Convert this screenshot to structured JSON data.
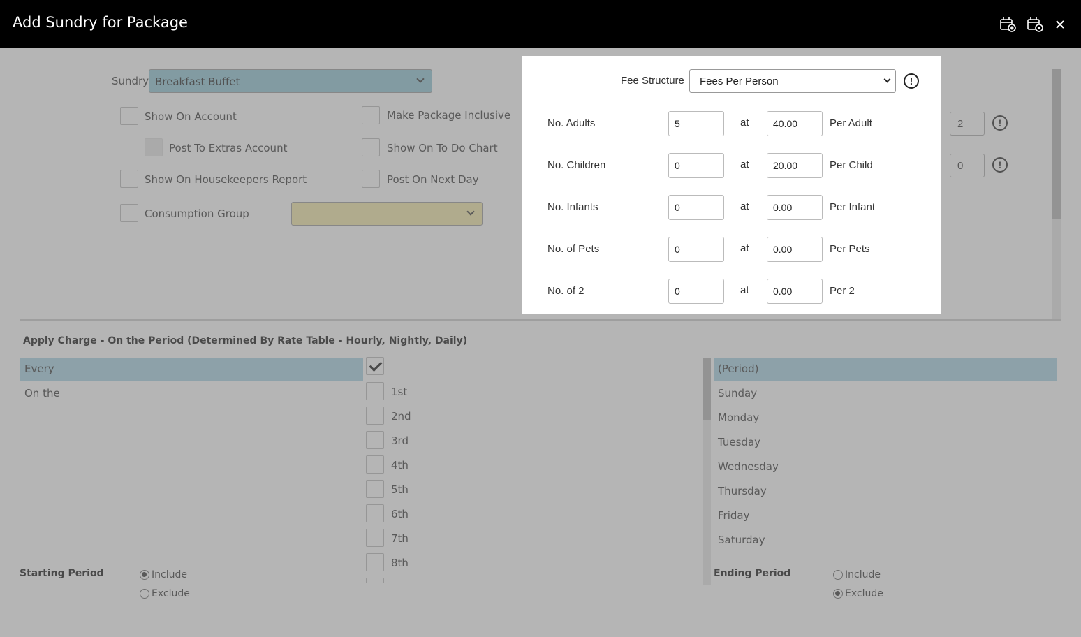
{
  "window": {
    "title": "Add Sundry for Package"
  },
  "header_icons": [
    "save-new-icon",
    "save-close-icon",
    "close-icon"
  ],
  "sundry": {
    "label": "Sundry",
    "value": "Breakfast Buffet"
  },
  "options": {
    "show_on_account": "Show On Account",
    "post_to_extras": "Post To Extras Account",
    "show_on_housekeepers": "Show On Housekeepers Report",
    "consumption_group": "Consumption Group",
    "make_package_inclusive": "Make Package Inclusive",
    "show_on_todo": "Show On To Do Chart",
    "post_next_day": "Post On Next Day"
  },
  "side_values": {
    "first": "2",
    "second": "0"
  },
  "apply_charge": {
    "heading": "Apply Charge - On the Period (Determined By Rate Table - Hourly, Nightly, Daily)",
    "frequency": [
      "Every",
      "On the"
    ],
    "selected_frequency": "Every",
    "ordinals": [
      "1st",
      "2nd",
      "3rd",
      "4th",
      "5th",
      "6th",
      "7th",
      "8th"
    ],
    "periods": [
      "(Period)",
      "Sunday",
      "Monday",
      "Tuesday",
      "Wednesday",
      "Thursday",
      "Friday",
      "Saturday"
    ],
    "selected_period": "(Period)"
  },
  "starting_period": {
    "label": "Starting Period",
    "include": "Include",
    "exclude": "Exclude",
    "selected": "Include"
  },
  "ending_period": {
    "label": "Ending Period",
    "include": "Include",
    "exclude": "Exclude",
    "selected": "Exclude"
  },
  "fee_popup": {
    "fee_structure_label": "Fee Structure",
    "fee_structure_value": "Fees Per Person",
    "at": "at",
    "rows": [
      {
        "label": "No. Adults",
        "qty": "5",
        "price": "40.00",
        "unit": "Per Adult"
      },
      {
        "label": "No. Children",
        "qty": "0",
        "price": "20.00",
        "unit": "Per Child"
      },
      {
        "label": "No. Infants",
        "qty": "0",
        "price": "0.00",
        "unit": "Per Infant"
      },
      {
        "label": "No. of Pets",
        "qty": "0",
        "price": "0.00",
        "unit": "Per Pets"
      },
      {
        "label": "No. of 2",
        "qty": "0",
        "price": "0.00",
        "unit": "Per 2"
      }
    ]
  },
  "colors": {
    "header": "#000000",
    "selected_row": "#a7d3e4",
    "sundry_select": "#8fc6d6",
    "consumption_select": "#f3e8a6"
  }
}
